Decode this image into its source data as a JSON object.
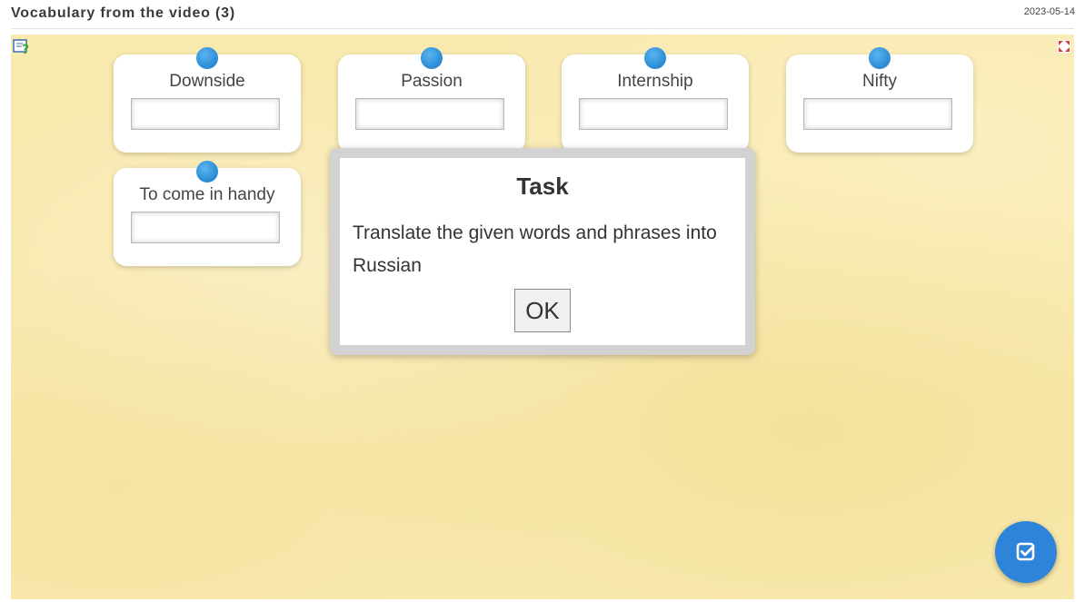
{
  "header": {
    "title": "Vocabulary from the video (3)",
    "date": "2023-05-14"
  },
  "toolbar": {
    "help_icon": "help-icon",
    "fullscreen_icon": "fullscreen-icon"
  },
  "cards": [
    {
      "label": "Downside",
      "value": ""
    },
    {
      "label": "Passion",
      "value": ""
    },
    {
      "label": "Internship",
      "value": ""
    },
    {
      "label": "Nifty",
      "value": ""
    },
    {
      "label": "To come in handy",
      "value": ""
    }
  ],
  "dialog": {
    "title": "Task",
    "text": "Translate the given words and phrases into Russian",
    "ok_label": "OK"
  },
  "check_button": {
    "icon": "check-icon",
    "color": "#2d84d8"
  },
  "colors": {
    "board_background": "#f8e9ae",
    "pin": "#2f8fd8",
    "dialog_border": "#d2d2d2"
  }
}
